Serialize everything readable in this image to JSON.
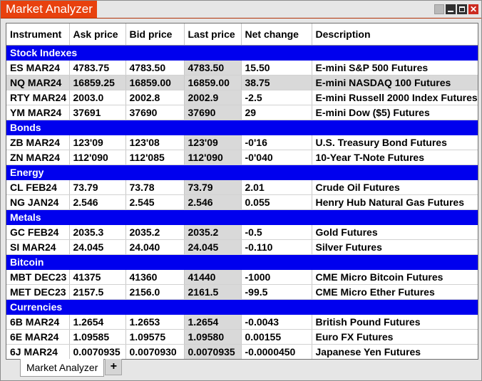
{
  "window": {
    "title": "Market Analyzer"
  },
  "columns": [
    "Instrument",
    "Ask price",
    "Bid price",
    "Last price",
    "Net change",
    "Description"
  ],
  "groups": [
    {
      "name": "Stock Indexes",
      "rows": [
        {
          "instrument": "ES MAR24",
          "ask": "4783.75",
          "bid": "4783.50",
          "last": "4783.50",
          "net": "15.50",
          "desc": "E-mini S&P 500 Futures",
          "selected": false
        },
        {
          "instrument": "NQ MAR24",
          "ask": "16859.25",
          "bid": "16859.00",
          "last": "16859.00",
          "net": "38.75",
          "desc": "E-mini NASDAQ 100 Futures",
          "selected": true
        },
        {
          "instrument": "RTY MAR24",
          "ask": "2003.0",
          "bid": "2002.8",
          "last": "2002.9",
          "net": "-2.5",
          "desc": "E-mini Russell 2000 Index Futures",
          "selected": false
        },
        {
          "instrument": "YM MAR24",
          "ask": "37691",
          "bid": "37690",
          "last": "37690",
          "net": "29",
          "desc": "E-mini Dow ($5) Futures",
          "selected": false
        }
      ]
    },
    {
      "name": "Bonds",
      "rows": [
        {
          "instrument": "ZB MAR24",
          "ask": "123'09",
          "bid": "123'08",
          "last": "123'09",
          "net": "-0'16",
          "desc": "U.S. Treasury Bond Futures",
          "selected": false
        },
        {
          "instrument": "ZN MAR24",
          "ask": "112'090",
          "bid": "112'085",
          "last": "112'090",
          "net": "-0'040",
          "desc": "10-Year T-Note Futures",
          "selected": false
        }
      ]
    },
    {
      "name": "Energy",
      "rows": [
        {
          "instrument": "CL FEB24",
          "ask": "73.79",
          "bid": "73.78",
          "last": "73.79",
          "net": "2.01",
          "desc": "Crude Oil Futures",
          "selected": false
        },
        {
          "instrument": "NG JAN24",
          "ask": "2.546",
          "bid": "2.545",
          "last": "2.546",
          "net": "0.055",
          "desc": "Henry Hub Natural Gas Futures",
          "selected": false
        }
      ]
    },
    {
      "name": "Metals",
      "rows": [
        {
          "instrument": "GC FEB24",
          "ask": "2035.3",
          "bid": "2035.2",
          "last": "2035.2",
          "net": "-0.5",
          "desc": "Gold Futures",
          "selected": false
        },
        {
          "instrument": "SI MAR24",
          "ask": "24.045",
          "bid": "24.040",
          "last": "24.045",
          "net": "-0.110",
          "desc": "Silver Futures",
          "selected": false
        }
      ]
    },
    {
      "name": "Bitcoin",
      "rows": [
        {
          "instrument": "MBT DEC23",
          "ask": "41375",
          "bid": "41360",
          "last": "41440",
          "net": "-1000",
          "desc": "CME Micro Bitcoin Futures",
          "selected": false
        },
        {
          "instrument": "MET DEC23",
          "ask": "2157.5",
          "bid": "2156.0",
          "last": "2161.5",
          "net": "-99.5",
          "desc": "CME Micro Ether Futures",
          "selected": false
        }
      ]
    },
    {
      "name": "Currencies",
      "rows": [
        {
          "instrument": "6B MAR24",
          "ask": "1.2654",
          "bid": "1.2653",
          "last": "1.2654",
          "net": "-0.0043",
          "desc": "British Pound Futures",
          "selected": false
        },
        {
          "instrument": "6E MAR24",
          "ask": "1.09585",
          "bid": "1.09575",
          "last": "1.09580",
          "net": "0.00155",
          "desc": "Euro FX Futures",
          "selected": false
        },
        {
          "instrument": "6J MAR24",
          "ask": "0.0070935",
          "bid": "0.0070930",
          "last": "0.0070935",
          "net": "-0.0000450",
          "desc": "Japanese Yen Futures",
          "selected": false
        }
      ]
    }
  ],
  "bottom_tabs": {
    "active": "Market Analyzer",
    "add": "+"
  },
  "colors": {
    "title_accent": "#e8410e",
    "group_header": "#0000ee",
    "last_price_bg": "#d9d9d9"
  },
  "icons": [
    "minimize-icon",
    "maximize-icon",
    "close-icon",
    "add-tab-icon"
  ]
}
